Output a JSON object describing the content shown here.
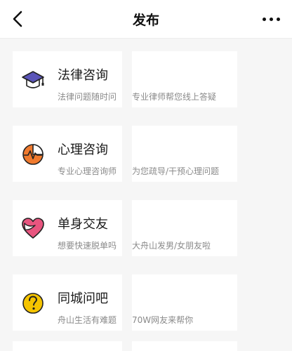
{
  "header": {
    "title": "发布",
    "back_icon": "chevron-left-icon",
    "more_icon": "more-dots-icon"
  },
  "items": [
    {
      "title": "法律咨询",
      "subtitle": "法律问题随时问",
      "description": "专业律师帮您线上答疑",
      "icon": "graduation-cap-icon"
    },
    {
      "title": "心理咨询",
      "subtitle": "专业心理咨询师",
      "description": "为您疏导/干预心理问题",
      "icon": "pulse-chart-icon"
    },
    {
      "title": "单身交友",
      "subtitle": "想要快速脱单吗",
      "description": "大舟山发男/女朋友啦",
      "icon": "heart-icon"
    },
    {
      "title": "同城问吧",
      "subtitle": "舟山生活有难题",
      "description": "70W网友来帮你",
      "icon": "question-circle-icon"
    }
  ],
  "colors": {
    "header_bg": "#ffffff",
    "page_bg": "#f6f6f6",
    "cap": "#5b55b8",
    "pulse": "#f07a2e",
    "heart": "#e8557f",
    "question": "#f5c400"
  }
}
